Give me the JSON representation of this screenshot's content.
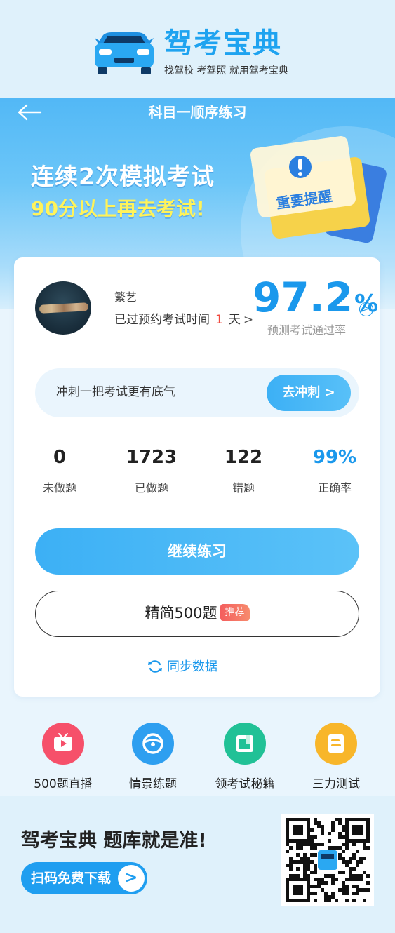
{
  "brand": {
    "name": "驾考宝典",
    "slogan": "找驾校 考驾照 就用驾考宝典"
  },
  "header": {
    "title": "科目一顺序练习"
  },
  "promo": {
    "line1": "连续2次模拟考试",
    "line2": "90分以上再去考试!",
    "notice_label": "重要提醒"
  },
  "user": {
    "name": "繁艺",
    "exam_text": "已过预约考试时间",
    "exam_days": "1",
    "exam_unit": "天",
    "exam_arrow": ">"
  },
  "prediction": {
    "value": "97.2",
    "unit": "%",
    "label": "预测考试通过率",
    "arrow": ">"
  },
  "sprint": {
    "text": "冲刺一把考试更有底气",
    "button": "去冲刺 >"
  },
  "stats": [
    {
      "value": "0",
      "label": "未做题"
    },
    {
      "value": "1723",
      "label": "已做题"
    },
    {
      "value": "122",
      "label": "错题"
    },
    {
      "value": "99%",
      "label": "正确率"
    }
  ],
  "actions": {
    "continue": "继续练习",
    "simplified": "精简500题",
    "recommend_badge": "推荐",
    "sync": "同步数据"
  },
  "quick_links": [
    {
      "label": "500题直播",
      "icon": "tv-icon",
      "color": "#f6506a"
    },
    {
      "label": "情景练题",
      "icon": "steering-wheel-icon",
      "color": "#2e9ff0"
    },
    {
      "label": "领考试秘籍",
      "icon": "book-icon",
      "color": "#21c196"
    },
    {
      "label": "三力测试",
      "icon": "document-icon",
      "color": "#f8b62a"
    }
  ],
  "footer": {
    "title": "驾考宝典 题库就是准!",
    "download": "扫码免费下载",
    "download_arrow": ">"
  },
  "colors": {
    "accent": "#1a98ec",
    "hero_blue": "#52b8f6",
    "promo_yellow": "#fff35a",
    "days_red": "#f0483e"
  }
}
